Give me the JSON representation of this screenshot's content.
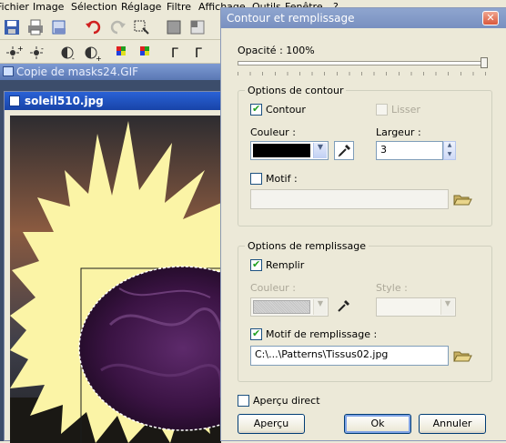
{
  "menu": [
    "Fichier",
    "Image",
    "Sélection",
    "Réglage",
    "Filtre",
    "Affichage",
    "Outils",
    "Fenêtre",
    "?"
  ],
  "background_windows": {
    "parent_title": "Copie de masks24.GIF",
    "image_title": "soleil510.jpg"
  },
  "dialog": {
    "title": "Contour et remplissage",
    "close_label": "✕",
    "opacity_label": "Opacité : 100%",
    "opacity_value_percent": 100,
    "stroke_group": {
      "label": "Options de contour",
      "contour_label": "Contour",
      "contour_checked": true,
      "lisser_label": "Lisser",
      "lisser_checked": false,
      "couleur_label": "Couleur :",
      "stroke_color": "#000000",
      "largeur_label": "Largeur :",
      "largeur_value": "3",
      "motif_label": "Motif :",
      "motif_checked": false
    },
    "fill_group": {
      "label": "Options de remplissage",
      "remplir_label": "Remplir",
      "remplir_checked": true,
      "couleur_label": "Couleur :",
      "fill_color": "#c8c8c8",
      "style_label": "Style :",
      "motif_label": "Motif de remplissage :",
      "motif_checked": true,
      "motif_path": "C:\\...\\Patterns\\Tissus02.jpg"
    },
    "apercu_direct_label": "Aperçu direct",
    "apercu_direct_checked": false,
    "buttons": {
      "preview": "Aperçu",
      "ok": "Ok",
      "cancel": "Annuler"
    }
  },
  "colors": {
    "accent_blue": "#2a62d6",
    "dialog_title_blue": "#7990c0",
    "check_green": "#21a121",
    "sun_yellow": "#fbf4a6",
    "purple_fabric": "#4a1a55"
  }
}
